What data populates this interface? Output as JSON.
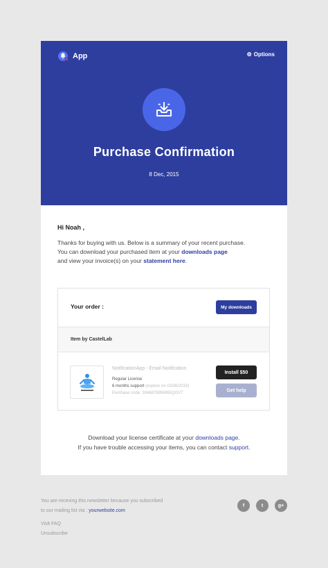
{
  "colors": {
    "primary": "#2d3e9f",
    "circle": "#4a66e8",
    "background": "#e8e8e8",
    "dark_button": "#222222",
    "muted_button": "#a9b0cf"
  },
  "header": {
    "app_name": "App",
    "options_label": "Options",
    "options_icon": "gear-icon",
    "brand_icon": "bell-icon"
  },
  "hero": {
    "icon": "download-tray-icon",
    "title": "Purchase Confirmation",
    "date": "8 Dec, 2015"
  },
  "greeting": "Hi Noah ,",
  "intro": {
    "line1": "Thanks for buying with us. Below is a summary of your recent purchase.",
    "line2_pre": "You can download your purchased item at your",
    "downloads_link": "downloads page",
    "line3_pre": "and view your invoice(s) on your",
    "statement_link": "statement here",
    "line3_post": "."
  },
  "order": {
    "title": "Your order :",
    "downloads_button": "My downloads",
    "seller": "Item by CastelLab",
    "product": {
      "thumbnail_icon": "meditation-figure-icon",
      "name": "NotificationApp - Email Notification",
      "license": "Regular License",
      "support": "6 months support",
      "support_expiry": "(expires on 03/06/2016)",
      "purchase_code": "Purchase code: 184687895W65QOVT"
    },
    "install_button": "Install $50",
    "help_button": "Get help"
  },
  "closing": {
    "line1_pre": "Download your license certificate at your",
    "downloads_link": "downloads page",
    "line1_post": ".",
    "line2_pre": "If you have trouble accessing your items, you can contact",
    "support_link": "support",
    "line2_post": "."
  },
  "footer": {
    "text_line1": "You are receving this newsletter because you subscribed",
    "text_line2_pre": "to our mailing list via :",
    "website_link": "yourwebsite.com",
    "faq_link": "Visit FAQ",
    "unsubscribe_link": "Unsubscribe",
    "socials": [
      {
        "icon": "facebook-icon",
        "glyph": "f"
      },
      {
        "icon": "twitter-icon",
        "glyph": "t"
      },
      {
        "icon": "google-plus-icon",
        "glyph": "g+"
      }
    ]
  }
}
